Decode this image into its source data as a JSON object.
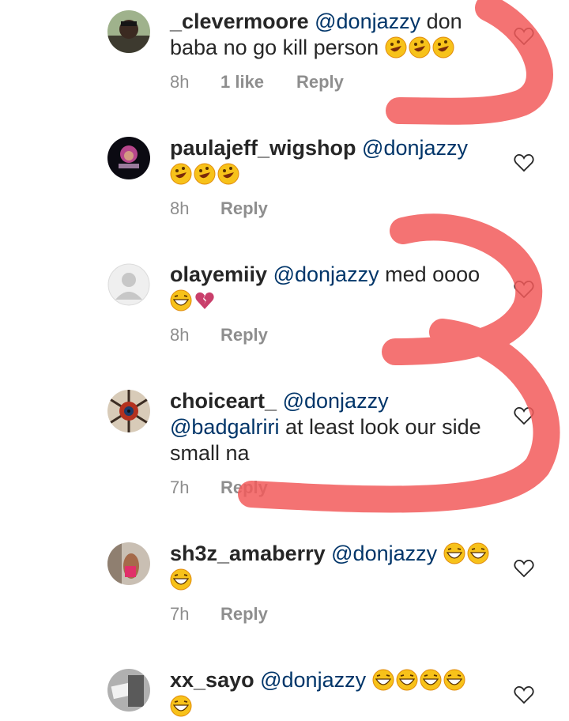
{
  "comments": [
    {
      "username": "_clevermoore",
      "mentions": [
        "@donjazzy"
      ],
      "text_line1_rest": " don",
      "text_line2": "baba no go kill person",
      "emojis_line2": [
        "rofl-emoji",
        "rofl-emoji",
        "rofl-emoji"
      ],
      "time": "8h",
      "likes": "1 like",
      "reply": "Reply"
    },
    {
      "username": "paulajeff_wigshop",
      "mentions": [
        "@donjazzy"
      ],
      "emojis_line2": [
        "rofl-emoji",
        "rofl-emoji",
        "rofl-emoji"
      ],
      "time": "8h",
      "reply": "Reply"
    },
    {
      "username": "olayemiiy",
      "mentions": [
        "@donjazzy"
      ],
      "text_line1_rest": " med oooo",
      "emojis_line2": [
        "grinning-squint-emoji",
        "broken-heart-emoji"
      ],
      "time": "8h",
      "reply": "Reply"
    },
    {
      "username": "choiceart_",
      "mentions": [
        "@donjazzy",
        "@badgalriri"
      ],
      "text_line2_rest": " at least look our side",
      "text_line3": "small na",
      "time": "7h",
      "reply": "Reply"
    },
    {
      "username": "sh3z_amaberry",
      "mentions": [
        "@donjazzy"
      ],
      "emojis_line1": [
        "grinning-squint-emoji",
        "grinning-squint-emoji"
      ],
      "emojis_line2": [
        "grinning-squint-emoji"
      ],
      "time": "7h",
      "reply": "Reply"
    },
    {
      "username": "xx_sayo",
      "mentions": [
        "@donjazzy"
      ],
      "emojis_line1": [
        "grinning-squint-emoji",
        "grinning-squint-emoji",
        "grinning-squint-emoji",
        "grinning-squint-emoji"
      ],
      "emojis_line2": [
        "grinning-squint-emoji"
      ]
    }
  ],
  "colors": {
    "text": "#262626",
    "mention": "#003569",
    "meta": "#8e8e8e",
    "annotation": "#f25a5a"
  },
  "icons": [
    "heart-outline-icon",
    "avatar-placeholder-icon"
  ]
}
